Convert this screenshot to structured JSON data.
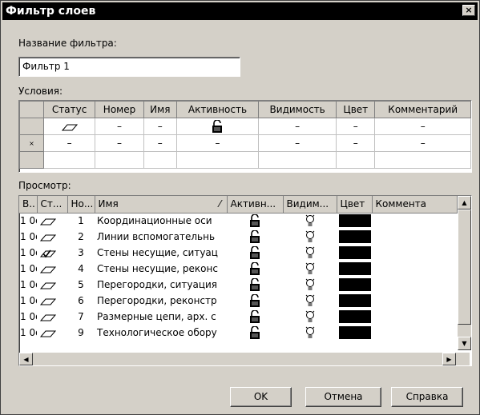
{
  "window": {
    "title": "Фильтр слоев",
    "close_glyph": "×"
  },
  "filter_name": {
    "label": "Название фильтра:",
    "value": "Фильтр 1"
  },
  "conditions": {
    "label": "Условия:",
    "columns": [
      "Статус",
      "Номер",
      "Имя",
      "Активность",
      "Видимость",
      "Цвет",
      "Комментарий"
    ],
    "rows": [
      {
        "header": "",
        "cells": [
          "status-icon",
          "–",
          "–",
          "lock-icon",
          "–",
          "–",
          "–"
        ]
      },
      {
        "header": "×",
        "cells": [
          "–",
          "–",
          "–",
          "–",
          "–",
          "–",
          "–"
        ]
      },
      {
        "header": "",
        "cells": [
          "",
          "",
          "",
          "",
          "",
          "",
          ""
        ]
      }
    ]
  },
  "view": {
    "label": "Просмотр:",
    "columns": [
      "В..",
      "Ст...",
      "Но...",
      "Имя",
      "Активн...",
      "Видим...",
      "Цвет",
      "Коммента"
    ],
    "rows": [
      {
        "v": "1 0q",
        "num": "1",
        "name": "Координационные оси",
        "checked": false
      },
      {
        "v": "1 0q",
        "num": "2",
        "name": "Линии вспомогательнь",
        "checked": false
      },
      {
        "v": "1 0q",
        "num": "3",
        "name": "Стены несущие, ситуац",
        "checked": true
      },
      {
        "v": "1 0q",
        "num": "4",
        "name": "Стены несущие, реконс",
        "checked": false
      },
      {
        "v": "1 0q",
        "num": "5",
        "name": "Перегородки, ситуация",
        "checked": false
      },
      {
        "v": "1 0q",
        "num": "6",
        "name": "Перегородки, реконстр",
        "checked": false
      },
      {
        "v": "1 0q",
        "num": "7",
        "name": "Размерные цепи, арх. с",
        "checked": false
      },
      {
        "v": "1 0q",
        "num": "9",
        "name": "Технологическое обору",
        "checked": false
      }
    ],
    "sort_glyph": "⁄",
    "color_swatch": "#000000"
  },
  "buttons": {
    "ok": "OK",
    "cancel": "Отмена",
    "help": "Справка"
  }
}
